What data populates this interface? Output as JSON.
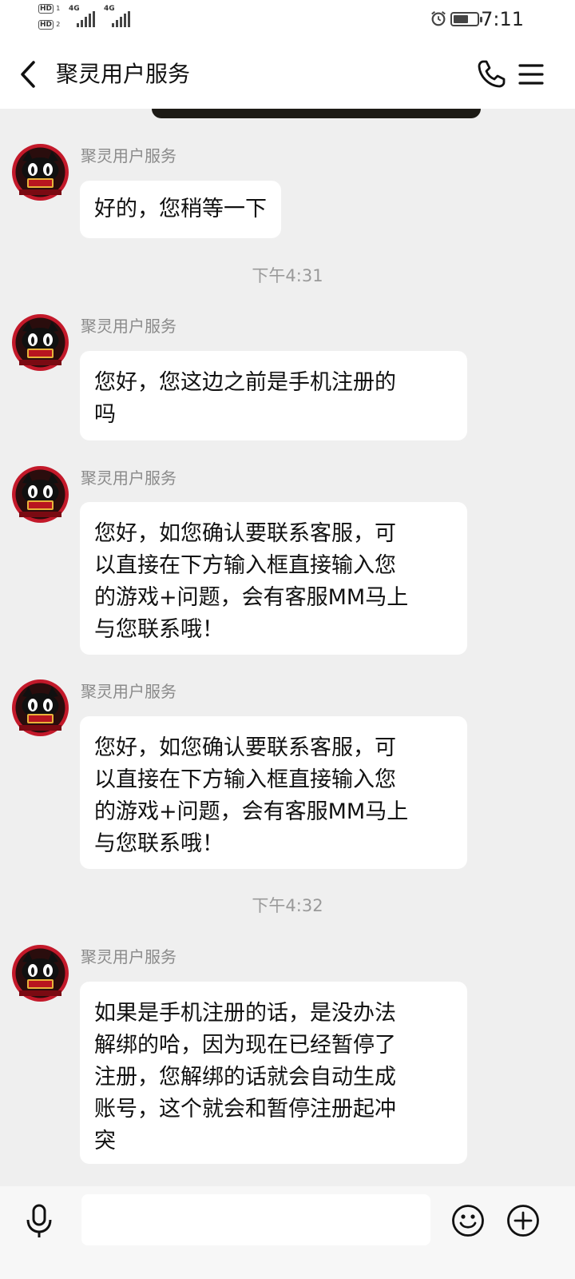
{
  "status_bar": {
    "hd1": "HD",
    "hd1_sub": "1",
    "hd2": "HD",
    "hd2_sub": "2",
    "network1": "4G",
    "network2": "4G",
    "time": "7:11"
  },
  "header": {
    "title": "聚灵用户服务",
    "icons": [
      "back-icon",
      "phone-icon",
      "menu-icon"
    ]
  },
  "messages": [
    {
      "type": "message",
      "sender": "聚灵用户服务",
      "text": "好的，您稍等一下"
    },
    {
      "type": "time",
      "text": "下午4:31"
    },
    {
      "type": "message",
      "sender": "聚灵用户服务",
      "text": "您好，您这边之前是手机注册的\n吗"
    },
    {
      "type": "message",
      "sender": "聚灵用户服务",
      "text": "您好，如您确认要联系客服，可\n以直接在下方输入框直接输入您\n的游戏+问题，会有客服MM马上\n与您联系哦！"
    },
    {
      "type": "message",
      "sender": "聚灵用户服务",
      "text": "您好，如您确认要联系客服，可\n以直接在下方输入框直接输入您\n的游戏+问题，会有客服MM马上\n与您联系哦！"
    },
    {
      "type": "time",
      "text": "下午4:32"
    },
    {
      "type": "message",
      "sender": "聚灵用户服务",
      "text": "如果是手机注册的话，是没办法\n解绑的哈，因为现在已经暂停了\n注册，您解绑的话就会自动生成\n账号，这个就会和暂停注册起冲\n突"
    }
  ],
  "avatar": {
    "badge_text": "聚灵",
    "sub_text": "Juling Huyu",
    "colors": {
      "ring": "#c3192a",
      "bg": "#2a0d0d",
      "cat": "#101010",
      "eyes": "#ffffff",
      "badge": "#e8b23a"
    }
  },
  "input_bar": {
    "placeholder": "",
    "value": "",
    "icons": [
      "mic-icon",
      "emoji-icon",
      "add-icon"
    ]
  }
}
